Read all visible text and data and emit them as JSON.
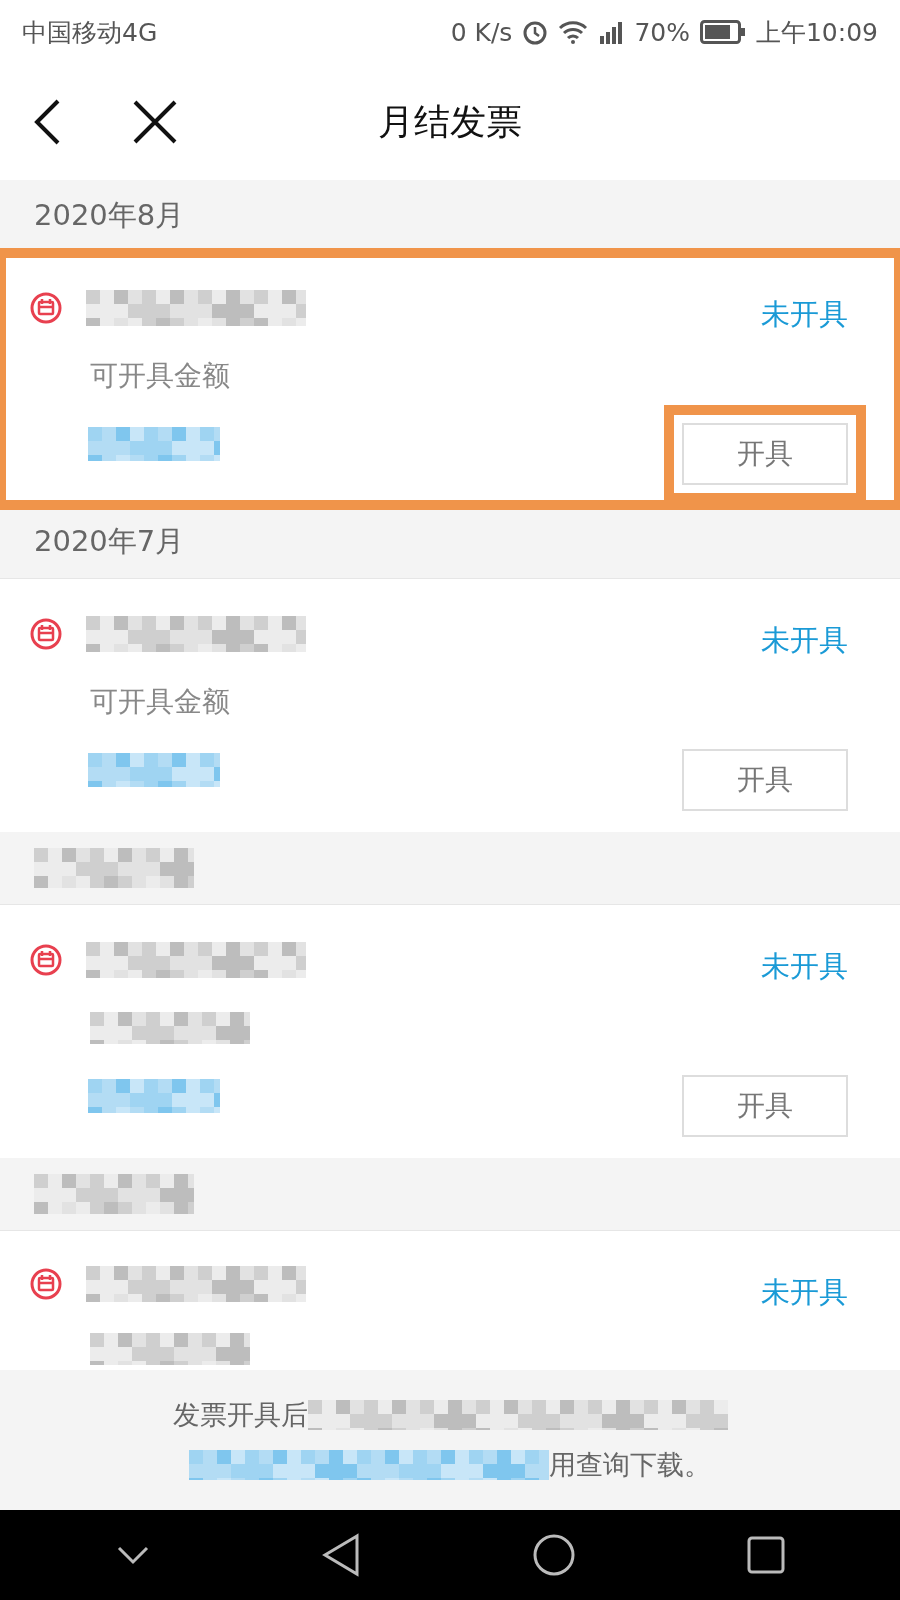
{
  "status_bar": {
    "carrier": "中国移动4G",
    "speed": "0 K/s",
    "battery": "70%",
    "time": "上午10:09"
  },
  "header": {
    "title": "月结发票"
  },
  "groups": [
    {
      "month": "2020年8月",
      "card": {
        "label": "可开具金额",
        "status": "未开具",
        "button": "开具",
        "highlighted": true,
        "button_highlighted": true
      }
    },
    {
      "month": "2020年7月",
      "card": {
        "label": "可开具金额",
        "status": "未开具",
        "button": "开具",
        "highlighted": false,
        "button_highlighted": false
      }
    },
    {
      "card": {
        "status": "未开具",
        "button": "开具",
        "highlighted": false,
        "button_highlighted": false
      }
    },
    {
      "card": {
        "status": "未开具",
        "highlighted": false
      }
    }
  ],
  "footer": {
    "line_start": "发票开具后",
    "line_end": "用查询下载。"
  }
}
